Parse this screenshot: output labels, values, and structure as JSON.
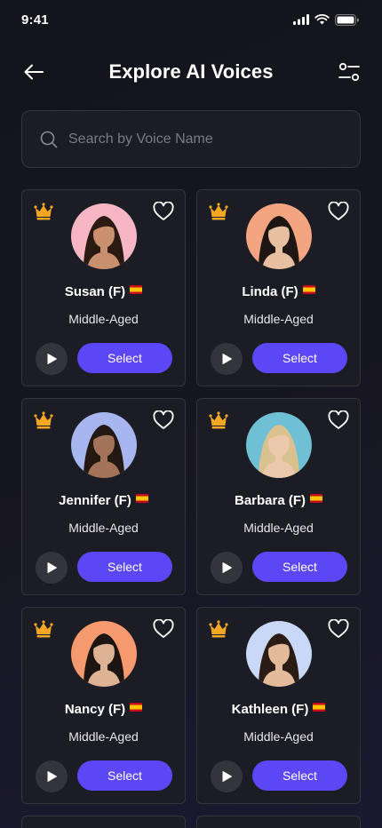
{
  "status_bar": {
    "time": "9:41"
  },
  "header": {
    "title": "Explore AI Voices"
  },
  "search": {
    "placeholder": "Search by Voice Name",
    "value": ""
  },
  "colors": {
    "accent": "#5b47f5",
    "crown": "#f5a623",
    "background": "#16161f",
    "card": "#1c1c24"
  },
  "voices": [
    {
      "name": "Susan (F)",
      "age": "Middle-Aged",
      "select_label": "Select",
      "flag": "spain-flag",
      "bg": "#f6b6c4",
      "skin": "#c9906e",
      "hair": "#2b1a12"
    },
    {
      "name": "Linda (F)",
      "age": "Middle-Aged",
      "select_label": "Select",
      "flag": "spain-flag",
      "bg": "#f3a582",
      "skin": "#e6c0a0",
      "hair": "#1e1612"
    },
    {
      "name": "Jennifer (F)",
      "age": "Middle-Aged",
      "select_label": "Select",
      "flag": "spain-flag",
      "bg": "#a8b6ef",
      "skin": "#a4745a",
      "hair": "#231812"
    },
    {
      "name": "Barbara (F)",
      "age": "Middle-Aged",
      "select_label": "Select",
      "flag": "spain-flag",
      "bg": "#6fc0d4",
      "skin": "#ecc9ad",
      "hair": "#d9c190"
    },
    {
      "name": "Nancy (F)",
      "age": "Middle-Aged",
      "select_label": "Select",
      "flag": "spain-flag",
      "bg": "#f59a6e",
      "skin": "#ddb394",
      "hair": "#1c1512"
    },
    {
      "name": "Kathleen (F)",
      "age": "Middle-Aged",
      "select_label": "Select",
      "flag": "spain-flag",
      "bg": "#c9d8f7",
      "skin": "#e3bb9a",
      "hair": "#2a1c14"
    }
  ]
}
